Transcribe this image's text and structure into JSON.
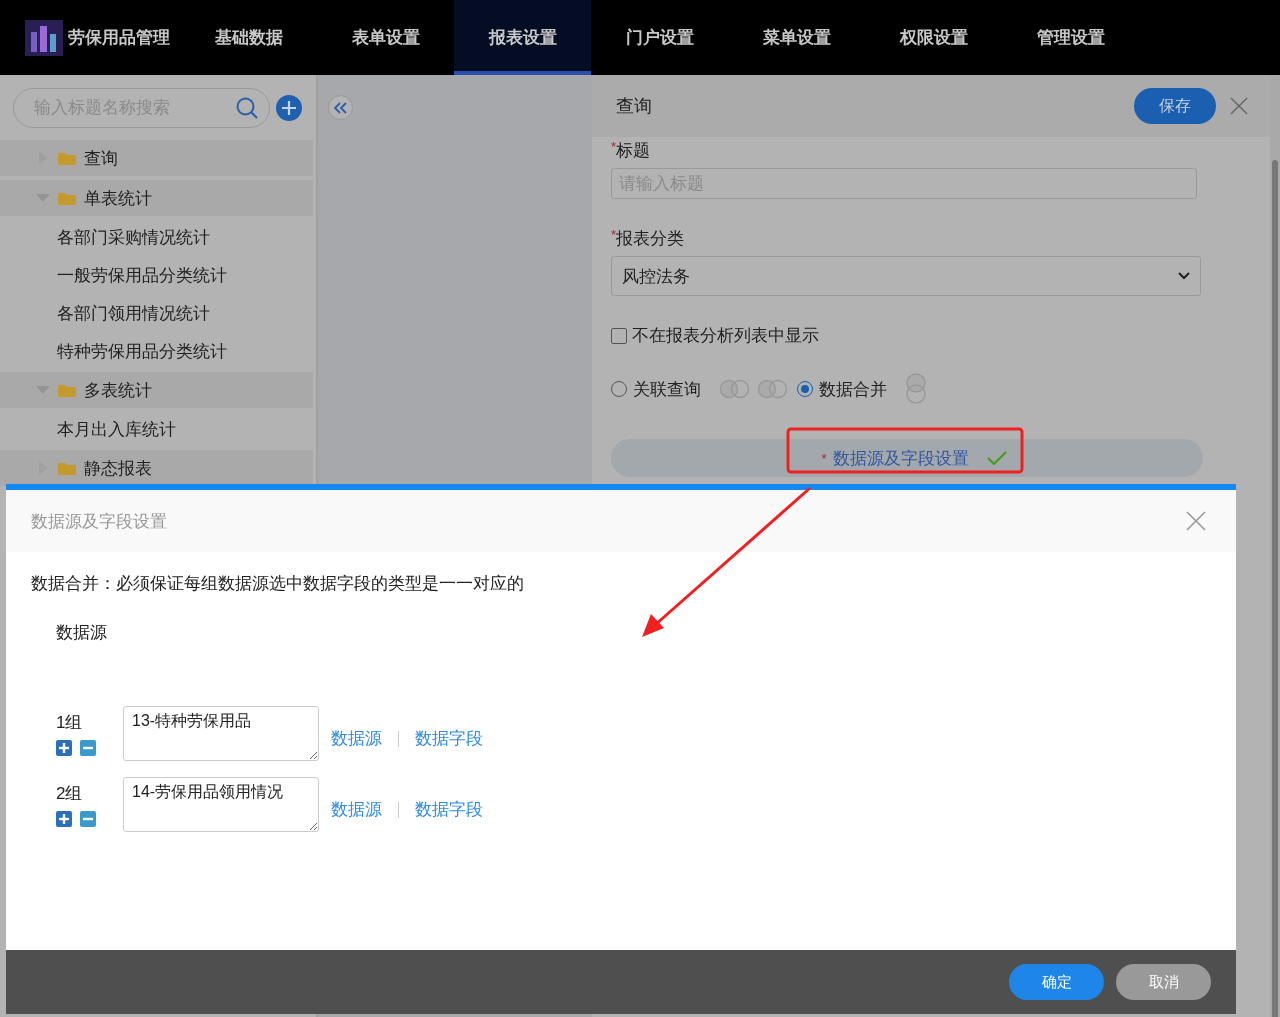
{
  "nav": {
    "brand": "劳保用品管理",
    "tabs": [
      {
        "label": "基础数据",
        "selected": false
      },
      {
        "label": "表单设置",
        "selected": false
      },
      {
        "label": "报表设置",
        "selected": true
      },
      {
        "label": "门户设置",
        "selected": false
      },
      {
        "label": "菜单设置",
        "selected": false
      },
      {
        "label": "权限设置",
        "selected": false
      },
      {
        "label": "管理设置",
        "selected": false
      }
    ]
  },
  "sidebar": {
    "search": {
      "placeholder": "输入标题名称搜索"
    },
    "tree": [
      {
        "label": "查询",
        "expanded": false
      },
      {
        "label": "单表统计",
        "expanded": true,
        "children": [
          {
            "label": "各部门采购情况统计"
          },
          {
            "label": "一般劳保用品分类统计"
          },
          {
            "label": "各部门领用情况统计"
          },
          {
            "label": "特种劳保用品分类统计"
          }
        ]
      },
      {
        "label": "多表统计",
        "expanded": true,
        "children": [
          {
            "label": "本月出入库统计"
          }
        ]
      },
      {
        "label": "静态报表",
        "expanded": false
      }
    ]
  },
  "editor": {
    "title": "查询",
    "save": "保存",
    "title_field": {
      "required_mark": "*",
      "label": "标题",
      "placeholder": "请输入标题"
    },
    "category_field": {
      "required_mark": "*",
      "label": "报表分类",
      "value": "风控法务"
    },
    "hide_option": {
      "label": "不在报表分析列表中显示",
      "checked": false
    },
    "modes": [
      {
        "kind": "join",
        "label": "关联查询",
        "selected": false
      },
      {
        "kind": "merge",
        "label": "数据合并",
        "selected": true
      }
    ],
    "datasource_button": {
      "required_mark": "*",
      "label": "数据源及字段设置",
      "done": true
    }
  },
  "dialog": {
    "title": "数据源及字段设置",
    "note": "数据合并：必须保证每组数据源选中数据字段的类型是一一对应的",
    "section": "数据源",
    "groups": [
      {
        "label": "1组",
        "value": "13-特种劳保用品",
        "links": [
          "数据源",
          "数据字段"
        ]
      },
      {
        "label": "2组",
        "value": "14-劳保用品领用情况",
        "links": [
          "数据源",
          "数据字段"
        ]
      }
    ],
    "buttons": [
      {
        "kind": "primary",
        "label": "确定"
      },
      {
        "kind": "secondary",
        "label": "取消"
      }
    ]
  }
}
